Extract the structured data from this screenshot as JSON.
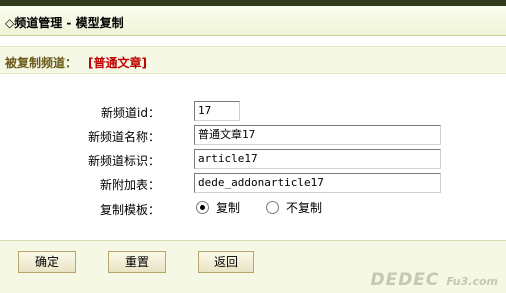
{
  "header": {
    "title": "◇频道管理 - 模型复制"
  },
  "subheader": {
    "label": "被复制频道：",
    "channel": "[普通文章]"
  },
  "form": {
    "new_id": {
      "label": "新频道id：",
      "value": "17"
    },
    "new_name": {
      "label": "新频道名称：",
      "value": "普通文章17"
    },
    "new_tag": {
      "label": "新频道标识：",
      "value": "article17"
    },
    "new_table": {
      "label": "新附加表：",
      "value": "dede_addonarticle17"
    },
    "copy_template": {
      "label": "复制模板：",
      "options": [
        {
          "label": "复制",
          "checked": true
        },
        {
          "label": "不复制",
          "checked": false
        }
      ]
    }
  },
  "footer": {
    "ok_label": "确定",
    "reset_label": "重置",
    "back_label": "返回"
  },
  "watermark": {
    "text": "DEDEC",
    "sub": "Fu3.com"
  },
  "colors": {
    "accent_red": "#c00000",
    "bar_green": "#f4f8e4"
  }
}
